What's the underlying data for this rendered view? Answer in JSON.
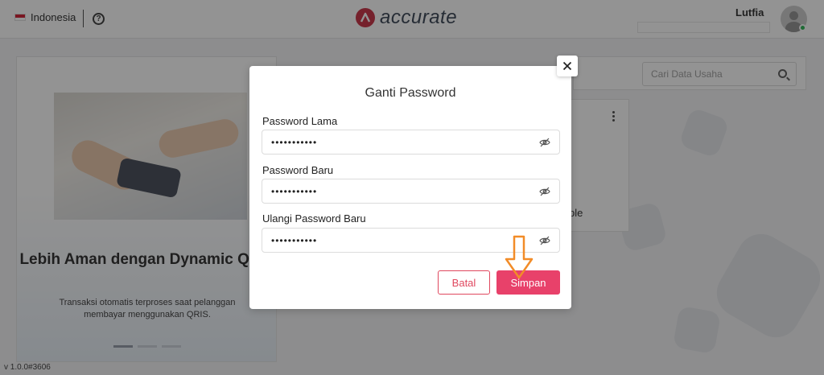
{
  "header": {
    "language": "Indonesia",
    "help_icon": "question-circle-icon",
    "brand": "accurate",
    "user_name": "Lutfia"
  },
  "promo": {
    "title": "Lebih Aman dengan Dynamic QRIS",
    "text": "Transaksi otomatis terproses saat pelanggan membayar menggunakan QRIS.",
    "active_slide": 1,
    "slides": 3
  },
  "version": "v 1.0.0#3606",
  "search": {
    "placeholder": "Cari Data Usaha"
  },
  "business_card": {
    "label": "ple"
  },
  "modal": {
    "title": "Ganti Password",
    "fields": [
      {
        "label": "Password Lama",
        "value": "•••••••••••"
      },
      {
        "label": "Password Baru",
        "value": "•••••••••••"
      },
      {
        "label": "Ulangi Password Baru",
        "value": "•••••••••••"
      }
    ],
    "cancel_label": "Batal",
    "save_label": "Simpan"
  },
  "colors": {
    "brand": "#c6263b",
    "primary_button": "#e8416a",
    "annotation_arrow": "#f28c28",
    "online": "#22b14c"
  }
}
